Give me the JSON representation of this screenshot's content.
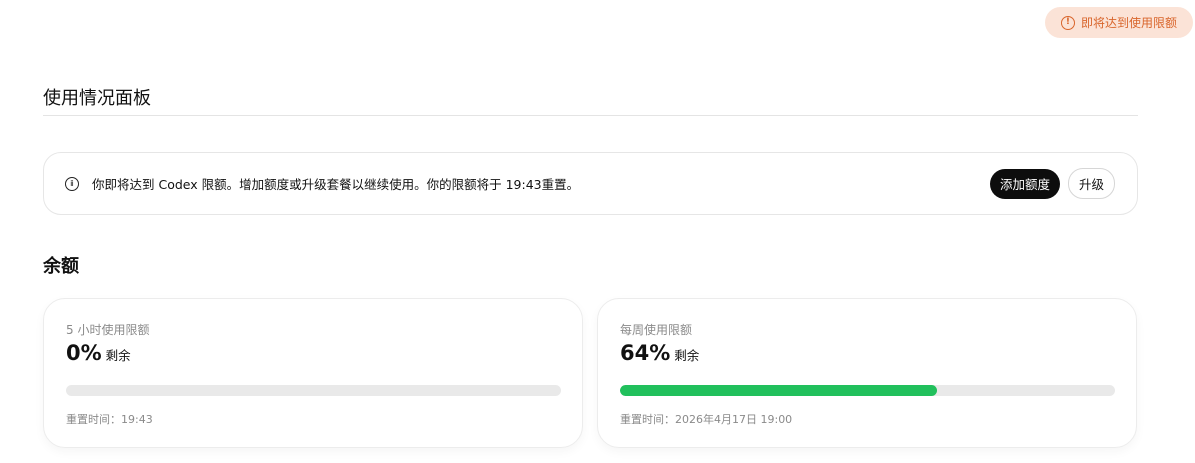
{
  "top_warning": {
    "label": "即将达到使用限额",
    "icon": "alert-circle-icon",
    "color": "#d9652b"
  },
  "page": {
    "title": "使用情况面板"
  },
  "banner": {
    "icon": "info-circle-icon",
    "text": "你即将达到 Codex 限额。增加额度或升级套餐以继续使用。你的限额将于 19:43重置。",
    "add_credits_label": "添加额度",
    "upgrade_label": "升级"
  },
  "balance": {
    "title": "余额",
    "cards": [
      {
        "label": "5 小时使用限额",
        "percent_text": "0%",
        "remaining_fraction": 0,
        "suffix": "剩余",
        "reset_text": "重置时间：19:43",
        "bar_color": "#21c05c"
      },
      {
        "label": "每周使用限额",
        "percent_text": "64%",
        "remaining_fraction": 0.64,
        "suffix": "剩余",
        "reset_text": "重置时间：2026年4月17日 19:00",
        "bar_color": "#21c05c"
      }
    ]
  }
}
